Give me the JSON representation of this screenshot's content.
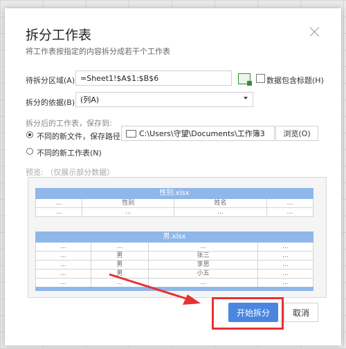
{
  "dialog": {
    "title": "拆分工作表",
    "subtitle": "将工作表按指定的内容拆分成若干个工作表"
  },
  "form": {
    "range_label": "待拆分区域(A):",
    "range_value": "=Sheet1!$A$1:$B$6",
    "header_checkbox_label": "数据包含标题(H)",
    "header_checked": false,
    "basis_label": "拆分的依据(B):",
    "basis_value": "(列A)",
    "save_section_label": "拆分后的工作表，保存到:",
    "option_new_file_label": "不同的新文件，保存路径(P)",
    "option_new_file_selected": true,
    "path_value": "C:\\Users\\守望\\Documents\\工作簿3",
    "browse_label": "浏览(O)",
    "option_new_sheet_label": "不同的新工作表(N)",
    "option_new_sheet_selected": false
  },
  "preview": {
    "label": "预览:  （仅展示部分数据）",
    "table1": {
      "title": "性别.xlsx",
      "rows": [
        [
          "...",
          "性别",
          "姓名",
          "..."
        ],
        [
          "...",
          "...",
          "...",
          "..."
        ]
      ]
    },
    "table2": {
      "title": "男.xlsx",
      "rows": [
        [
          "...",
          "...",
          "...",
          "..."
        ],
        [
          "...",
          "男",
          "张三",
          "..."
        ],
        [
          "...",
          "男",
          "李思",
          "..."
        ],
        [
          "...",
          "男",
          "小五",
          "..."
        ],
        [
          "...",
          "...",
          "...",
          "..."
        ]
      ]
    }
  },
  "buttons": {
    "start_label": "开始拆分",
    "cancel_label": "取消"
  },
  "colors": {
    "accent": "#4a86e0",
    "preview_header": "#8fb7ea",
    "annotation": "#e83030"
  }
}
